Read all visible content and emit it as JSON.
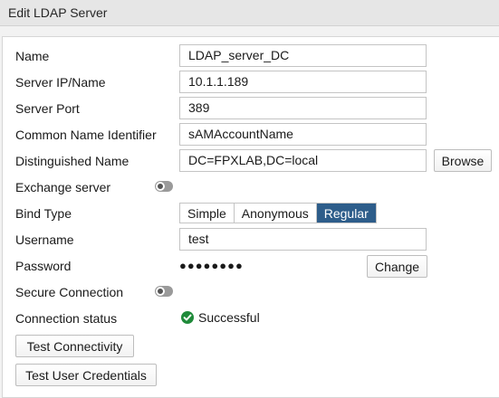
{
  "window": {
    "title": "Edit LDAP Server"
  },
  "form": {
    "name": {
      "label": "Name",
      "value": "LDAP_server_DC"
    },
    "server_ip": {
      "label": "Server IP/Name",
      "value": "10.1.1.189"
    },
    "server_port": {
      "label": "Server Port",
      "value": "389"
    },
    "common_name": {
      "label": "Common Name Identifier",
      "value": "sAMAccountName"
    },
    "distinguished_name": {
      "label": "Distinguished Name",
      "value": "DC=FPXLAB,DC=local",
      "browse_label": "Browse"
    },
    "exchange_server": {
      "label": "Exchange server",
      "enabled": false
    },
    "bind_type": {
      "label": "Bind Type",
      "options": [
        "Simple",
        "Anonymous",
        "Regular"
      ],
      "selected": "Regular"
    },
    "username": {
      "label": "Username",
      "value": "test"
    },
    "password": {
      "label": "Password",
      "masked": "●●●●●●●●",
      "change_label": "Change"
    },
    "secure_connection": {
      "label": "Secure Connection",
      "enabled": false
    },
    "connection_status": {
      "label": "Connection status",
      "value": "Successful",
      "icon": "check-circle-icon",
      "color": "#1f8a3a"
    },
    "test_connectivity_label": "Test Connectivity",
    "test_user_credentials_label": "Test User Credentials"
  },
  "colors": {
    "accent": "#2d5d8a",
    "success": "#1f8a3a"
  }
}
